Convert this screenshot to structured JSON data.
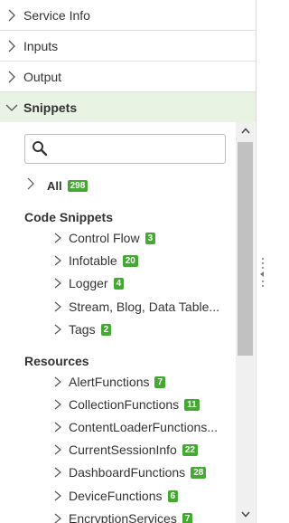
{
  "sections": [
    {
      "label": "Service Info"
    },
    {
      "label": "Inputs"
    },
    {
      "label": "Output"
    },
    {
      "label": "Snippets"
    }
  ],
  "search": {
    "placeholder": ""
  },
  "all": {
    "label": "All",
    "count": "298"
  },
  "code_snippets": {
    "title": "Code Snippets",
    "items": [
      {
        "label": "Control Flow",
        "count": "3"
      },
      {
        "label": "Infotable",
        "count": "20"
      },
      {
        "label": "Logger",
        "count": "4"
      },
      {
        "label": "Stream, Blog, Data Table...",
        "count": ""
      },
      {
        "label": "Tags",
        "count": "2"
      }
    ]
  },
  "resources": {
    "title": "Resources",
    "items": [
      {
        "label": "AlertFunctions",
        "count": "7"
      },
      {
        "label": "CollectionFunctions",
        "count": "11"
      },
      {
        "label": "ContentLoaderFunctions...",
        "count": ""
      },
      {
        "label": "CurrentSessionInfo",
        "count": "22"
      },
      {
        "label": "DashboardFunctions",
        "count": "28"
      },
      {
        "label": "DeviceFunctions",
        "count": "6"
      },
      {
        "label": "EncryptionServices",
        "count": "7"
      }
    ]
  },
  "colors": {
    "accent_green": "#44a833",
    "open_section_bg": "#e8f3e4"
  }
}
